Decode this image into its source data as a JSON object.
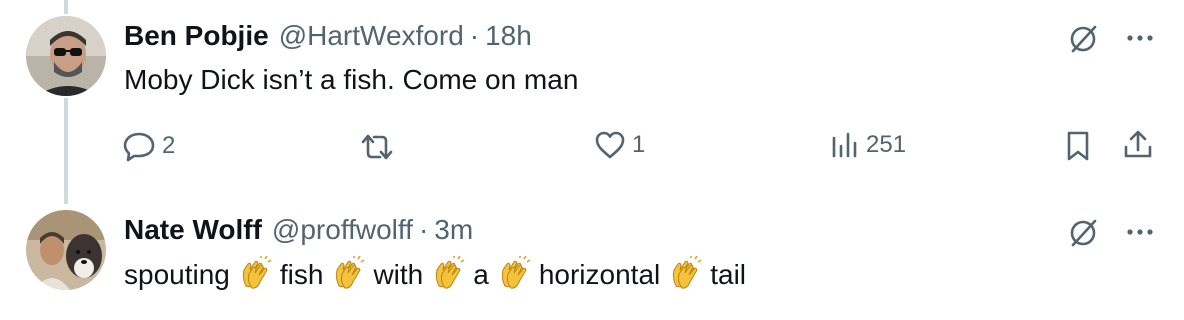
{
  "tweets": [
    {
      "display_name": "Ben Pobjie",
      "handle": "@HartWexford",
      "separator": "·",
      "time": "18h",
      "text": "Moby Dick isn’t a fish. Come on man",
      "actions": {
        "replies": "2",
        "retweets": "",
        "likes": "1",
        "views": "251"
      }
    },
    {
      "display_name": "Nate Wolff",
      "handle": "@proffwolff",
      "separator": "·",
      "time": "3m",
      "text_parts": [
        "spouting",
        "fish",
        "with",
        "a",
        "horizontal",
        "tail"
      ],
      "emoji": "clapping-hands"
    }
  ],
  "colors": {
    "text": "#0f1419",
    "secondary": "#536471",
    "thread_line": "#cfd9de",
    "clap_yellow": "#f5c33b"
  }
}
